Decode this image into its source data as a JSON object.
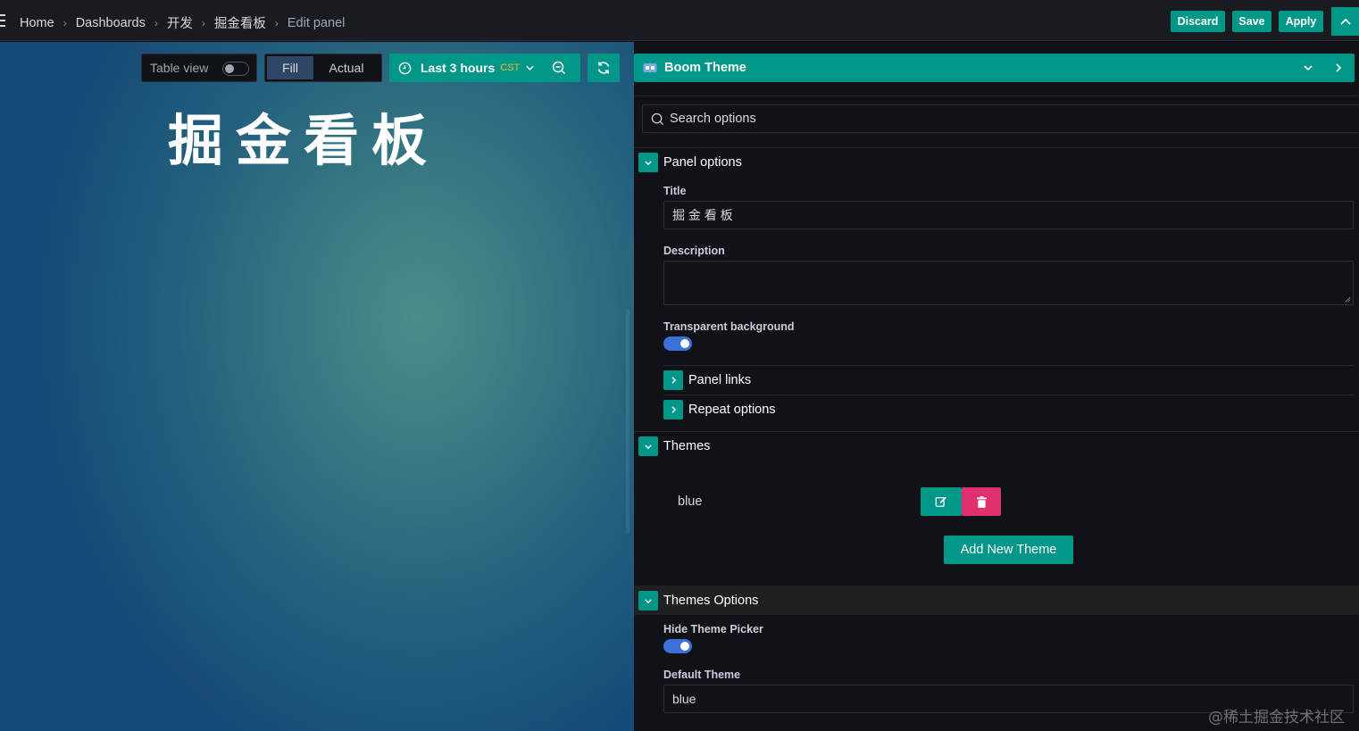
{
  "breadcrumbs": [
    {
      "label": "Home"
    },
    {
      "label": "Dashboards"
    },
    {
      "label": "开发"
    },
    {
      "label": "掘金看板"
    },
    {
      "label": "Edit panel"
    }
  ],
  "topbar": {
    "discard_label": "Discard",
    "save_label": "Save",
    "apply_label": "Apply"
  },
  "toolbar": {
    "table_view_label": "Table view",
    "table_view_on": false,
    "fill_label": "Fill",
    "actual_label": "Actual",
    "time_range_label": "Last 3 hours",
    "timezone_label": "CST"
  },
  "panel": {
    "title": "掘金看板"
  },
  "visualization": {
    "name": "Boom Theme"
  },
  "search": {
    "placeholder": "Search options"
  },
  "panel_options": {
    "header": "Panel options",
    "title_label": "Title",
    "title_value": "掘 金 看 板",
    "description_label": "Description",
    "description_value": "",
    "transparent_label": "Transparent background",
    "transparent_on": true,
    "panel_links_label": "Panel links",
    "repeat_options_label": "Repeat options"
  },
  "themes": {
    "header": "Themes",
    "items": [
      {
        "name": "blue"
      }
    ],
    "add_label": "Add New Theme"
  },
  "themes_options": {
    "header": "Themes Options",
    "hide_picker_label": "Hide Theme Picker",
    "hide_picker_on": true,
    "default_theme_label": "Default Theme",
    "default_theme_value": "blue"
  },
  "watermark": "@稀土掘金技术社区",
  "colors": {
    "accent": "#009688",
    "danger": "#e02f6f",
    "toggle_on": "#3d71d9",
    "background": "#111217"
  }
}
